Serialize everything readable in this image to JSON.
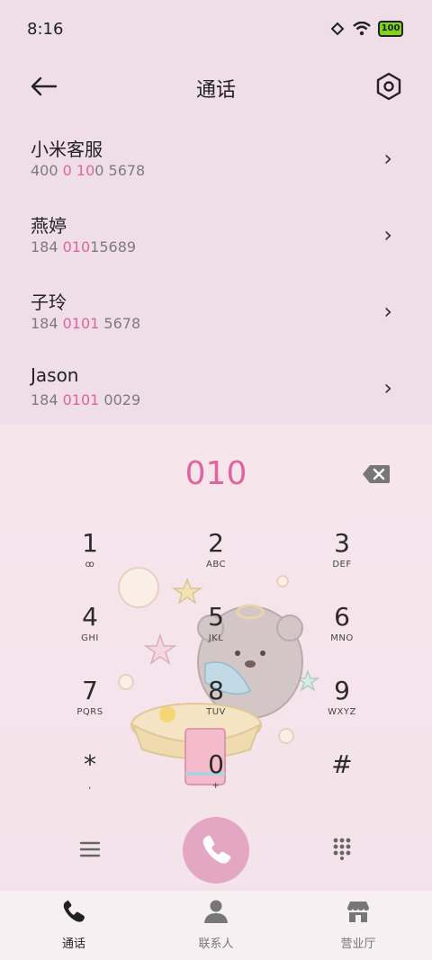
{
  "status": {
    "time": "8:16",
    "battery": "100"
  },
  "header": {
    "title": "通话"
  },
  "contacts": [
    {
      "name": "小米客服",
      "number_pre": "400 ",
      "number_hl": "0 10",
      "number_post": "0 5678"
    },
    {
      "name": "燕婷",
      "number_pre": "184 ",
      "number_hl": "010",
      "number_post": "15689"
    },
    {
      "name": "子玲",
      "number_pre": "184 ",
      "number_hl": "0101",
      "number_post": " 5678"
    },
    {
      "name": "Jason",
      "number_pre": "184 ",
      "number_hl": "0101",
      "number_post": " 0029"
    }
  ],
  "dialer": {
    "input": "010",
    "keys": [
      {
        "digit": "1",
        "letters": "ꝏ"
      },
      {
        "digit": "2",
        "letters": "ABC"
      },
      {
        "digit": "3",
        "letters": "DEF"
      },
      {
        "digit": "4",
        "letters": "GHI"
      },
      {
        "digit": "5",
        "letters": "JKL"
      },
      {
        "digit": "6",
        "letters": "MNO"
      },
      {
        "digit": "7",
        "letters": "PQRS"
      },
      {
        "digit": "8",
        "letters": "TUV"
      },
      {
        "digit": "9",
        "letters": "WXYZ"
      },
      {
        "digit": "*",
        "letters": ","
      },
      {
        "digit": "0",
        "letters": "+"
      },
      {
        "digit": "#",
        "letters": ""
      }
    ]
  },
  "tabs": [
    {
      "label": "通话"
    },
    {
      "label": "联系人"
    },
    {
      "label": "营业厅"
    }
  ],
  "colors": {
    "accent": "#e0649d",
    "call_button": "#e4a7c3"
  }
}
